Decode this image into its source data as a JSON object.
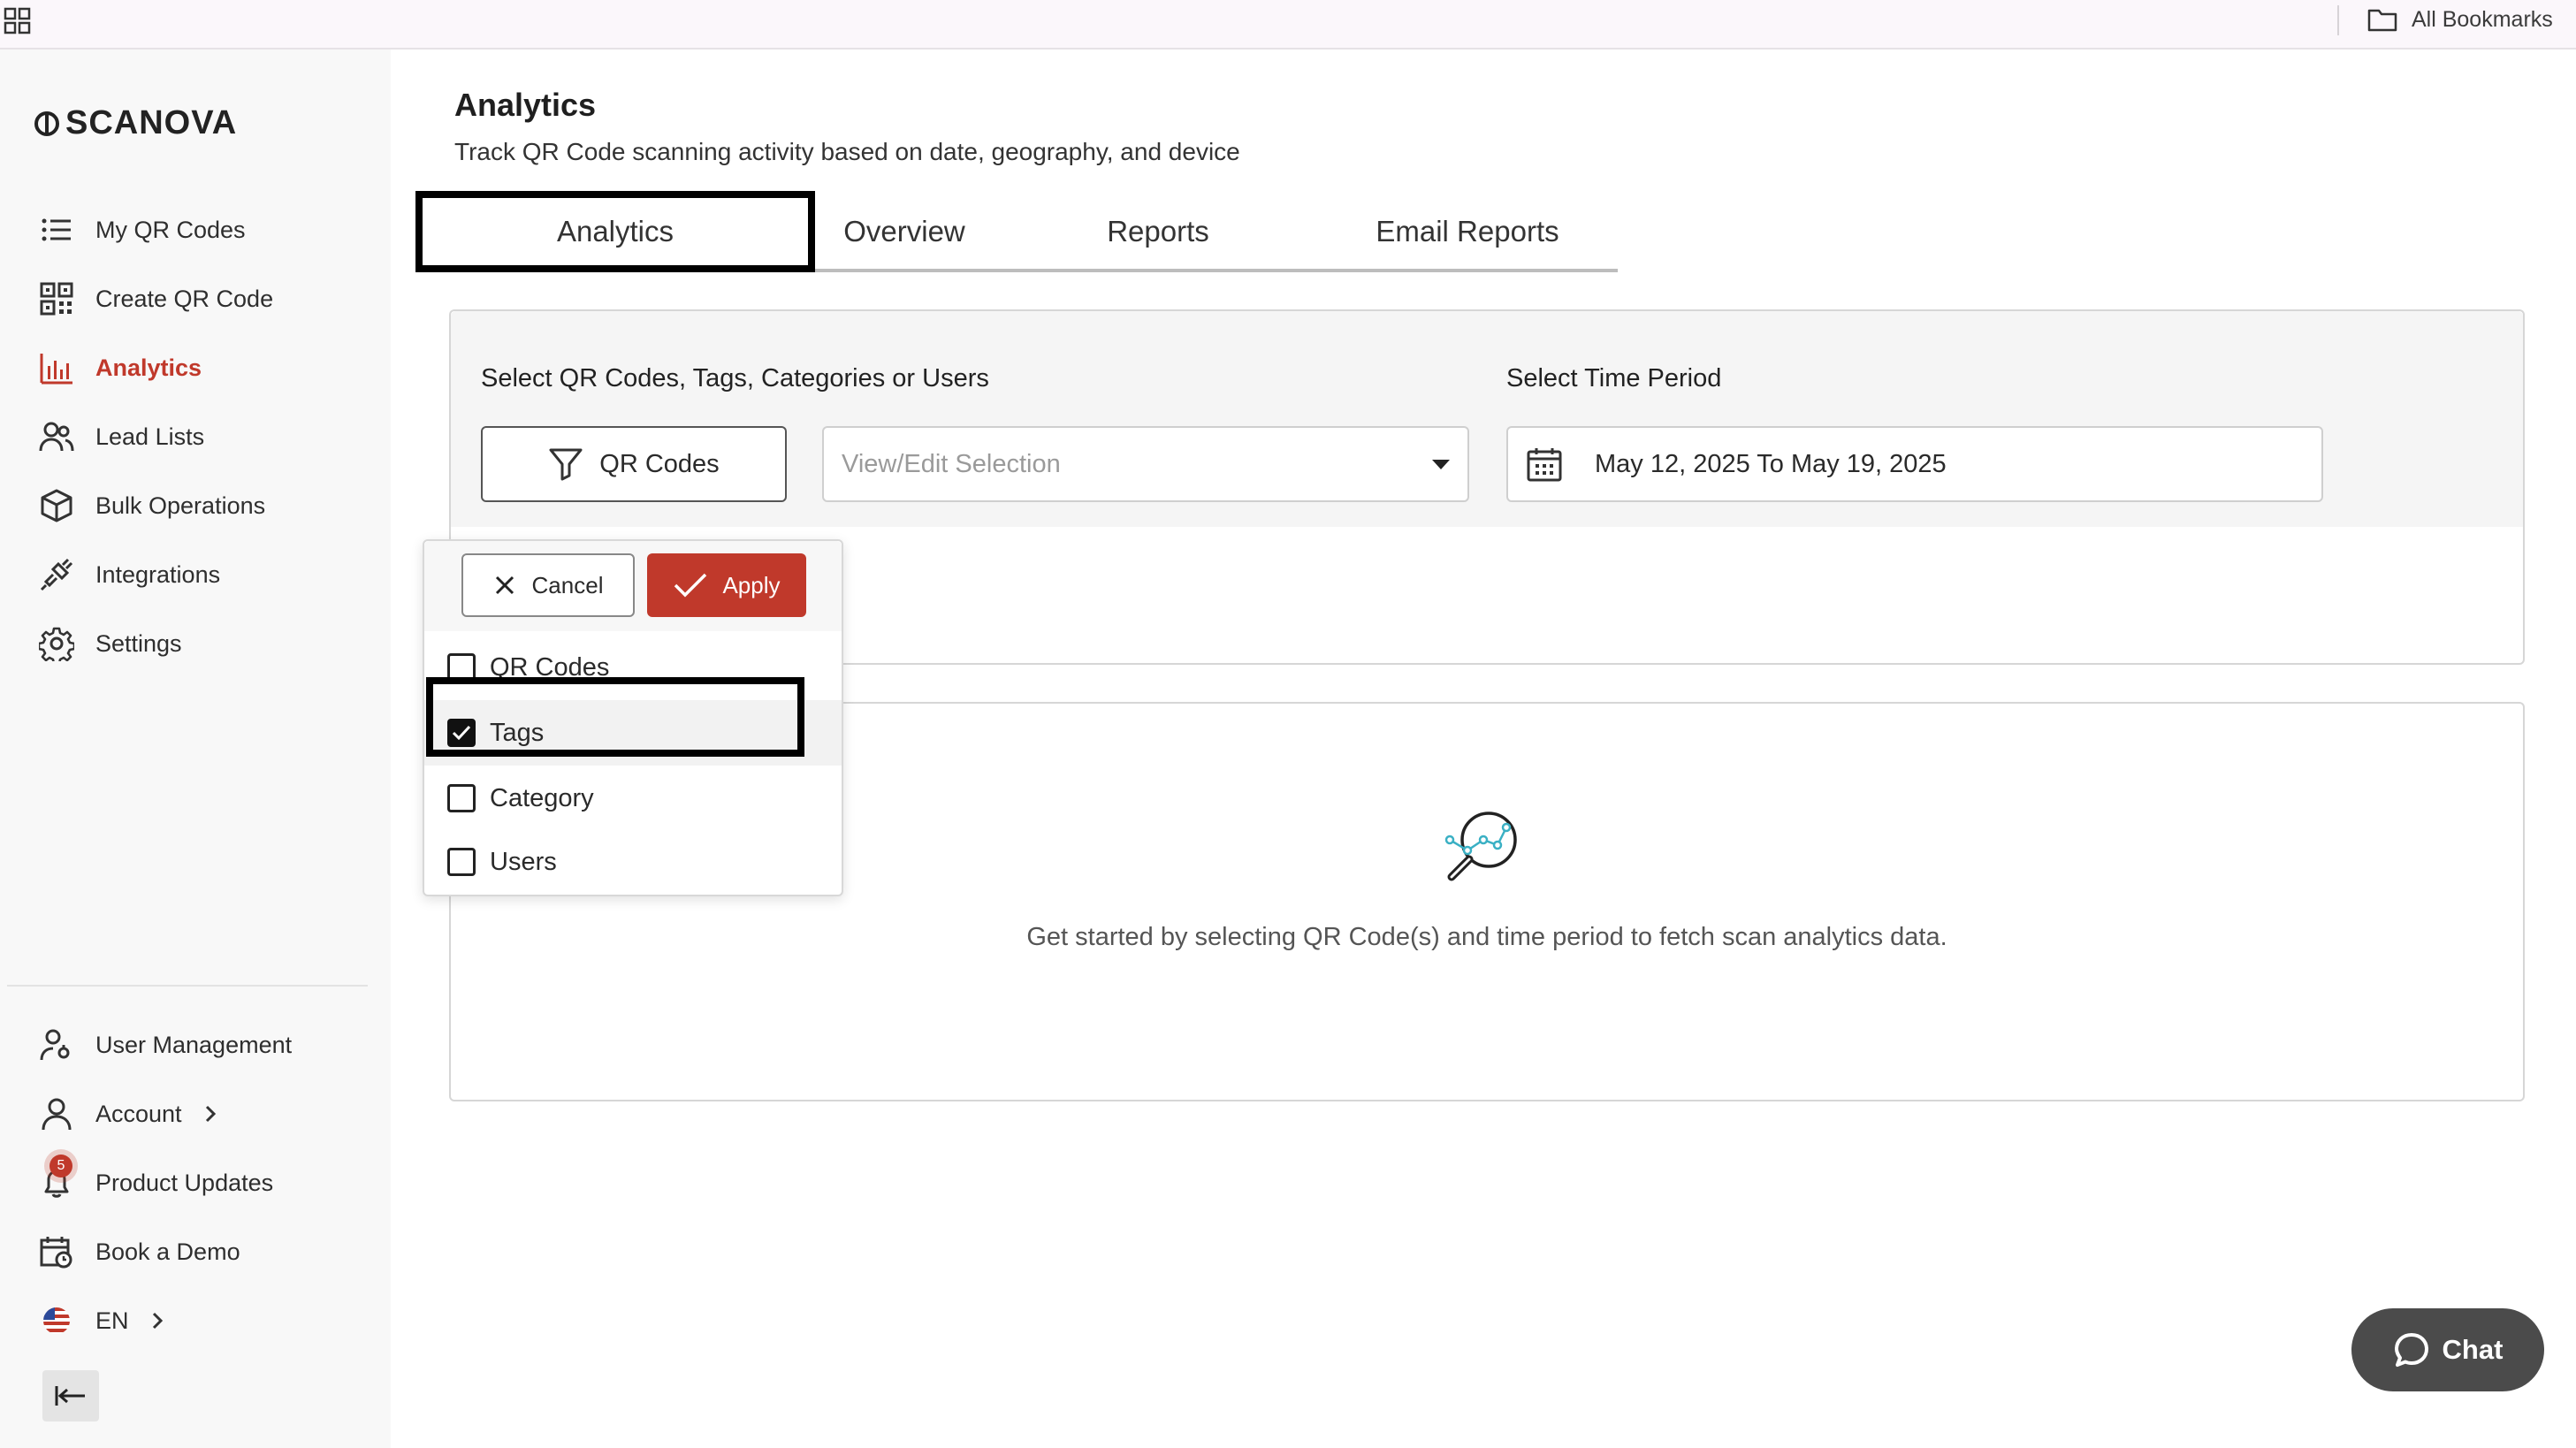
{
  "browser": {
    "all_bookmarks": "All Bookmarks"
  },
  "sidebar": {
    "logo_text": "SCANOVA",
    "nav_items": [
      {
        "label": "My QR Codes",
        "icon": "list-icon"
      },
      {
        "label": "Create QR Code",
        "icon": "qr-code-icon"
      },
      {
        "label": "Analytics",
        "icon": "bar-chart-icon",
        "active": true
      },
      {
        "label": "Lead Lists",
        "icon": "users-icon"
      },
      {
        "label": "Bulk Operations",
        "icon": "cube-icon"
      },
      {
        "label": "Integrations",
        "icon": "plug-icon"
      },
      {
        "label": "Settings",
        "icon": "gear-icon"
      }
    ],
    "bottom_items": [
      {
        "label": "User Management",
        "icon": "user-key-icon"
      },
      {
        "label": "Account",
        "icon": "user-icon"
      },
      {
        "label": "Product Updates",
        "icon": "bell-icon",
        "badge": "5"
      },
      {
        "label": "Book a Demo",
        "icon": "calendar-clock-icon"
      },
      {
        "label": "EN",
        "icon": "us-flag-icon"
      }
    ]
  },
  "page": {
    "title": "Analytics",
    "subtitle": "Track QR Code scanning activity based on date, geography, and device"
  },
  "tabs": [
    {
      "label": "Analytics",
      "active": true
    },
    {
      "label": "Overview"
    },
    {
      "label": "Reports"
    },
    {
      "label": "Email Reports"
    }
  ],
  "filters": {
    "select_label": "Select QR Codes, Tags, Categories or Users",
    "time_label": "Select Time Period",
    "type_button": "QR Codes",
    "selection_placeholder": "View/Edit Selection",
    "date_range": "May 12, 2025 To May 19, 2025"
  },
  "dropdown": {
    "cancel": "Cancel",
    "apply": "Apply",
    "options": [
      {
        "label": "QR Codes",
        "checked": false
      },
      {
        "label": "Tags",
        "checked": true
      },
      {
        "label": "Category",
        "checked": false
      },
      {
        "label": "Users",
        "checked": false
      }
    ]
  },
  "empty_state": {
    "message": "Get started by selecting QR Code(s) and time period to fetch scan analytics data."
  },
  "chat": {
    "label": "Chat"
  },
  "colors": {
    "accent": "#c0392b",
    "chat_bg": "#4b4b4b"
  }
}
